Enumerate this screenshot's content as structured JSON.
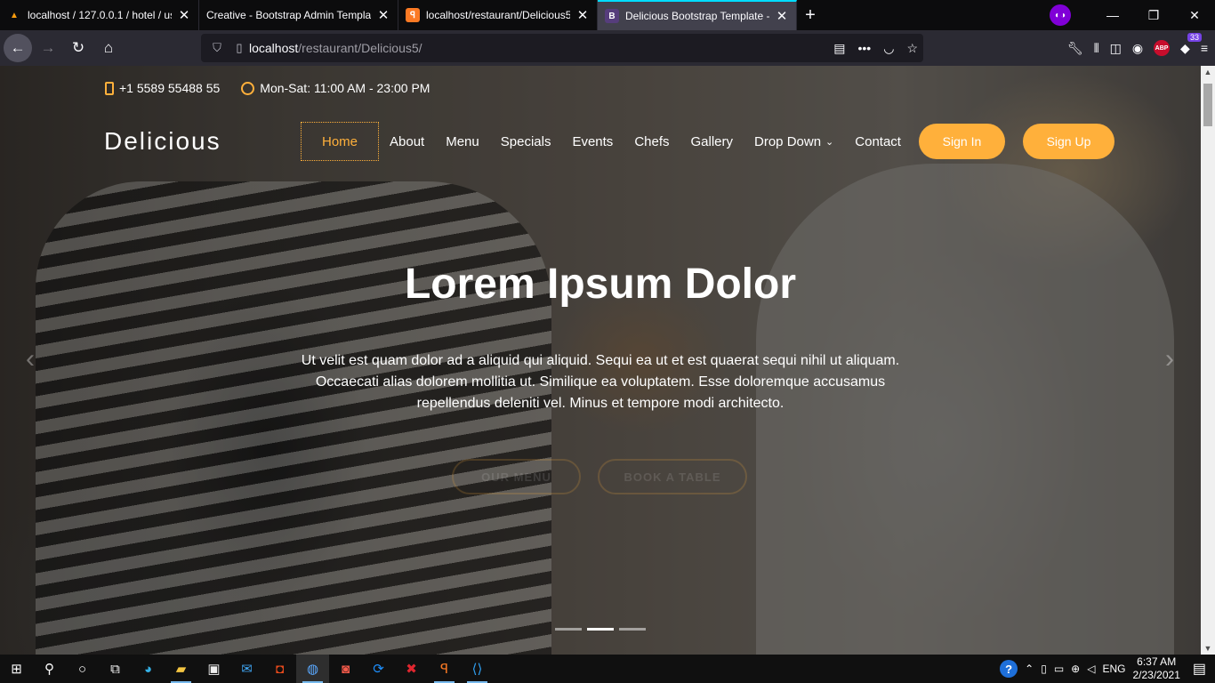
{
  "browser": {
    "tabs": [
      {
        "title": "localhost / 127.0.0.1 / hotel / us",
        "favicon": "phpmyadmin-icon",
        "active": false
      },
      {
        "title": "Creative - Bootstrap Admin Templa",
        "favicon": "none",
        "active": false
      },
      {
        "title": "localhost/restaurant/Delicious5",
        "favicon": "xampp-icon",
        "active": false
      },
      {
        "title": "Delicious Bootstrap Template -",
        "favicon": "bootstrap-icon",
        "active": true
      }
    ],
    "url_host": "localhost",
    "url_path": "/restaurant/Delicious5/",
    "abp_label": "ABP",
    "extension_badge": "33",
    "private_icon": "private-mask-icon"
  },
  "site": {
    "phone": "+1 5589 55488 55",
    "hours": "Mon-Sat: 11:00 AM - 23:00 PM",
    "brand": "Delicious",
    "nav": [
      "Home",
      "About",
      "Menu",
      "Specials",
      "Events",
      "Chefs",
      "Gallery",
      "Drop Down",
      "Contact"
    ],
    "sign_in": "Sign In",
    "sign_up": "Sign Up",
    "hero_title": "Lorem Ipsum Dolor",
    "hero_text": "Ut velit est quam dolor ad a aliquid qui aliquid. Sequi ea ut et est quaerat sequi nihil ut aliquam. Occaecati alias dolorem mollitia ut. Similique ea voluptatem. Esse doloremque accusamus repellendus deleniti vel. Minus et tempore modi architecto.",
    "cta_menu": "OUR MENU",
    "cta_book": "BOOK A TABLE",
    "slides_total": 3,
    "slide_active": 2,
    "colors": {
      "accent": "#ffb03b"
    }
  },
  "taskbar": {
    "language": "ENG",
    "time": "6:37 AM",
    "date": "2/23/2021"
  }
}
